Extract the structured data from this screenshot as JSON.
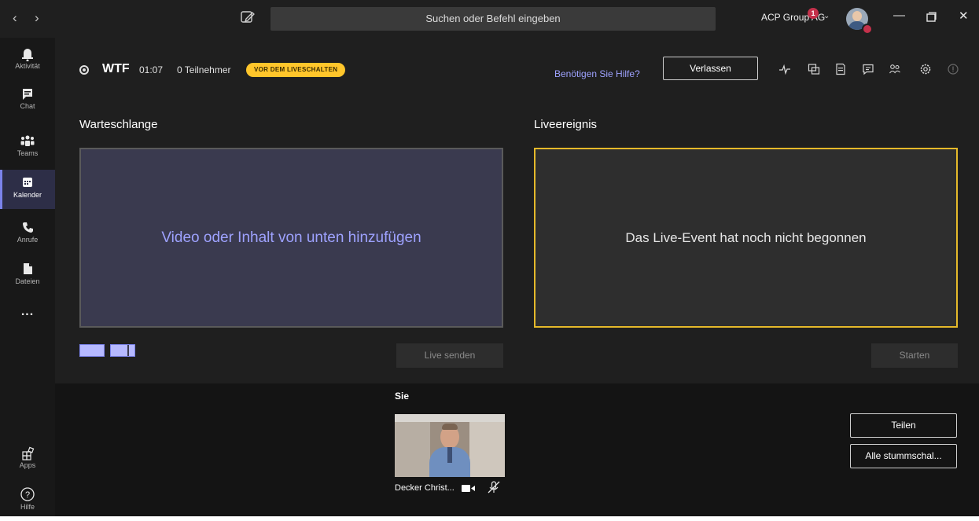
{
  "titlebar": {
    "back_icon": "chevron-left-icon",
    "forward_icon": "chevron-right-icon",
    "compose_icon": "compose-icon",
    "search_placeholder": "Suchen oder Befehl eingeben",
    "org_name": "ACP Group AG",
    "notification_count": "1",
    "window_controls": [
      "minimize-icon",
      "maximize-icon",
      "close-icon"
    ]
  },
  "rail": {
    "items": [
      {
        "label": "Aktivität",
        "icon": "bell-icon"
      },
      {
        "label": "Chat",
        "icon": "chat-icon"
      },
      {
        "label": "Teams",
        "icon": "teams-icon"
      },
      {
        "label": "Kalender",
        "icon": "calendar-icon",
        "active": true
      },
      {
        "label": "Anrufe",
        "icon": "phone-icon"
      },
      {
        "label": "Dateien",
        "icon": "file-icon"
      }
    ],
    "more": "...",
    "apps_label": "Apps",
    "help_label": "Hilfe"
  },
  "event": {
    "title": "WTF",
    "time": "01:07",
    "participants": "0 Teilnehmer",
    "status": "VOR DEM LIVESCHALTEN",
    "help_link": "Benötigen Sie Hilfe?",
    "leave_label": "Verlassen",
    "tools": [
      "health-icon",
      "qa-icon",
      "notes-icon",
      "chat-icon",
      "participants-icon",
      "settings-icon",
      "info-icon"
    ]
  },
  "queue": {
    "title": "Warteschlange",
    "placeholder": "Video oder Inhalt von unten hinzufügen",
    "send_label": "Live senden"
  },
  "live": {
    "title": "Liveereignis",
    "placeholder": "Das Live-Event hat noch nicht begonnen",
    "start_label": "Starten"
  },
  "participants": {
    "you_label": "Sie",
    "name": "Decker Christ...",
    "share_label": "Teilen",
    "mute_all_label": "Alle stummschal..."
  },
  "colors": {
    "accent": "#7b83eb",
    "badge": "#ffc62b",
    "live_border": "#e5b92a"
  }
}
